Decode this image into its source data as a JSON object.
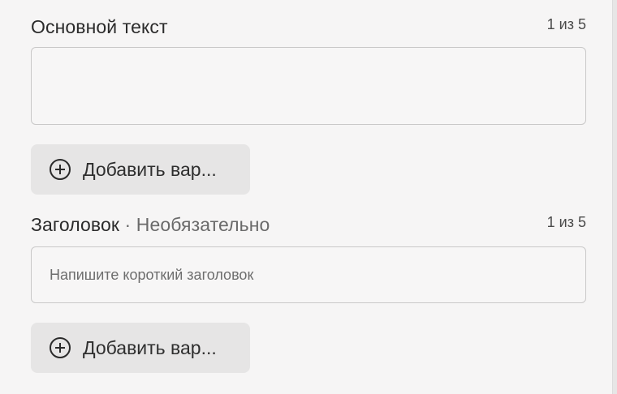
{
  "body_text": {
    "label": "Основной текст",
    "counter": "1 из 5",
    "value": "",
    "add_button_label": "Добавить вар..."
  },
  "headline": {
    "label": "Заголовок",
    "optional_suffix": " · Необязательно",
    "counter": "1 из 5",
    "placeholder": "Напишите короткий заголовок",
    "add_button_label": "Добавить вар..."
  },
  "icons": {
    "add": "plus-circle-icon"
  }
}
